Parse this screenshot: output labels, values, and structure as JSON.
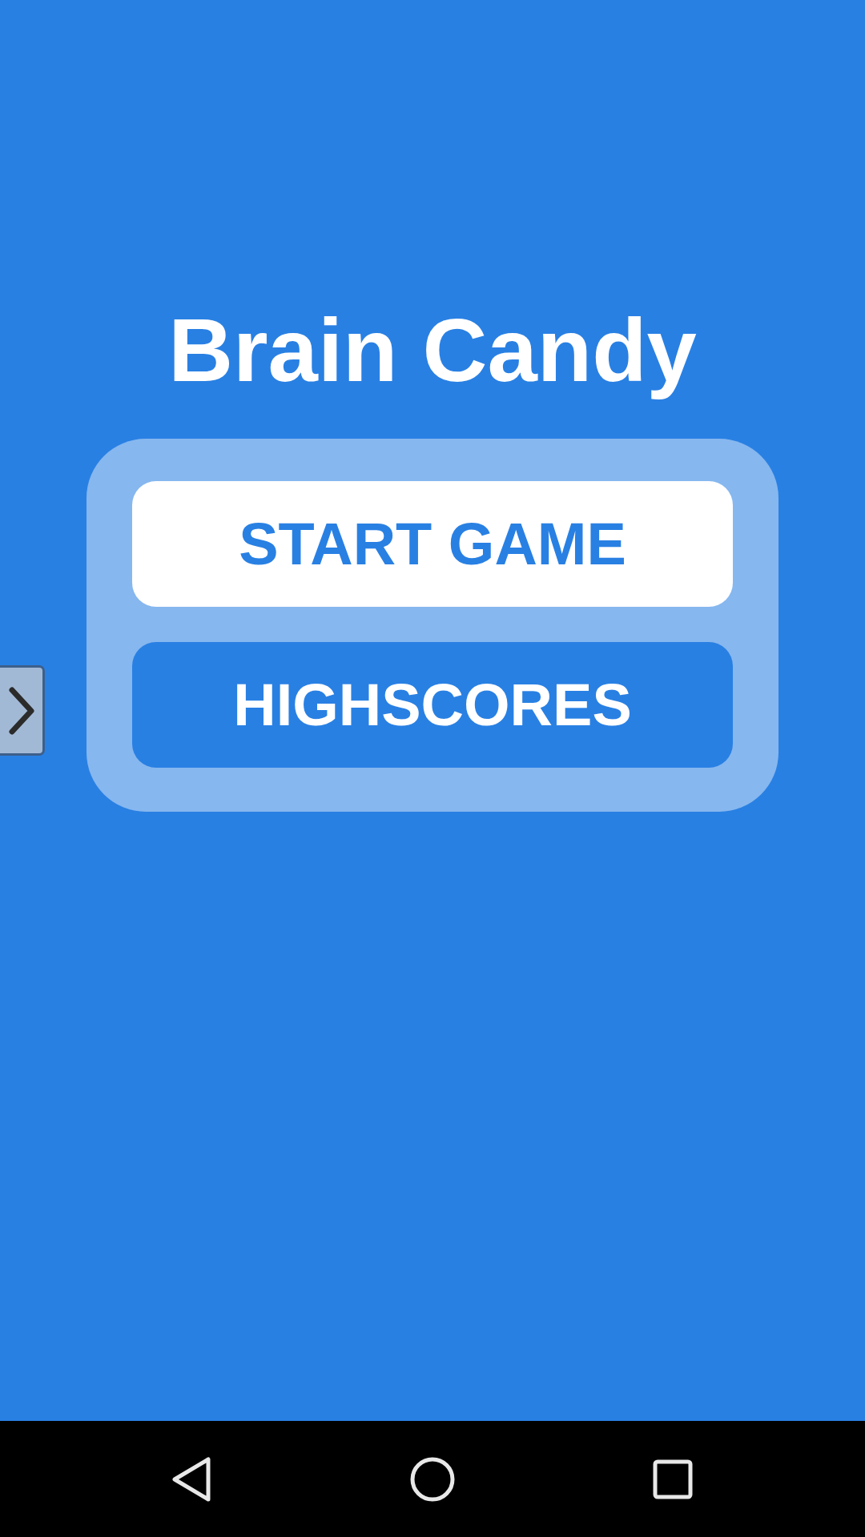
{
  "app_title": "Brain Candy",
  "menu": {
    "buttons": [
      {
        "label": "START GAME",
        "selected": true
      },
      {
        "label": "HIGHSCORES",
        "selected": false
      }
    ]
  }
}
